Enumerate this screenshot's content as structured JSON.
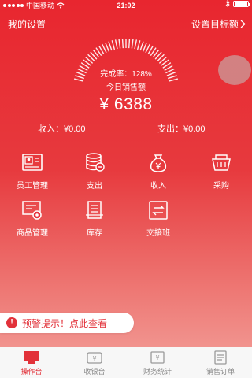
{
  "status": {
    "carrier": "中国移动",
    "time": "21:02"
  },
  "header": {
    "left": "我的设置",
    "right": "设置目标额"
  },
  "gauge": {
    "completion_rate": "完成率：128%",
    "completion_value": 1.28,
    "today_label": "今日销售额",
    "amount": "¥ 6388"
  },
  "summary": {
    "income": "收入：¥0.00",
    "expense": "支出：¥0.00"
  },
  "grid": [
    {
      "label": "员工管理",
      "icon": "id-card-icon"
    },
    {
      "label": "支出",
      "icon": "coins-icon"
    },
    {
      "label": "收入",
      "icon": "money-bag-icon"
    },
    {
      "label": "采购",
      "icon": "basket-icon"
    },
    {
      "label": "商品管理",
      "icon": "product-gear-icon"
    },
    {
      "label": "库存",
      "icon": "stock-icon"
    },
    {
      "label": "交接班",
      "icon": "shift-exchange-icon"
    }
  ],
  "alert": {
    "text": "预警提示！点此查看"
  },
  "tabs": [
    {
      "label": "操作台",
      "icon": "console-icon",
      "active": true
    },
    {
      "label": "收银台",
      "icon": "cash-register-icon",
      "active": false
    },
    {
      "label": "财务统计",
      "icon": "finance-icon",
      "active": false
    },
    {
      "label": "销售订单",
      "icon": "order-icon",
      "active": false
    }
  ],
  "colors": {
    "primary": "#e2323a",
    "background_top": "#e8262f",
    "background_bottom": "#f3a29c",
    "tab_inactive": "#888888"
  }
}
